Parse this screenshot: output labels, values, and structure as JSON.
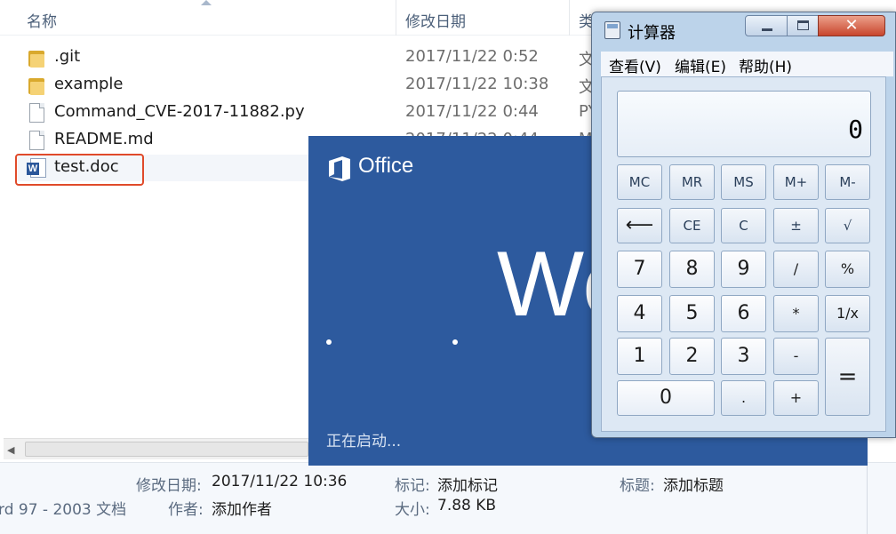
{
  "explorer": {
    "columns": {
      "name": "名称",
      "modified": "修改日期",
      "type": "类"
    },
    "files": [
      {
        "name": ".git",
        "modified": "2017/11/22 0:52",
        "type": "文",
        "icon": "folder-icon"
      },
      {
        "name": "example",
        "modified": "2017/11/22 10:38",
        "type": "文",
        "icon": "folder-icon"
      },
      {
        "name": "Command_CVE-2017-11882.py",
        "modified": "2017/11/22 0:44",
        "type": "PY",
        "icon": "file-icon"
      },
      {
        "name": "README.md",
        "modified": "2017/11/22 0:44",
        "type": "M",
        "icon": "file-icon"
      },
      {
        "name": "test.doc",
        "modified": "",
        "type": "",
        "icon": "word-doc-icon",
        "selected": true
      }
    ],
    "highlight_color": "#e04a2a"
  },
  "details": {
    "modified_label": "修改日期:",
    "modified_value": "2017/11/22 10:36",
    "tags_label": "标记:",
    "tags_value": "添加标记",
    "title_label": "标题:",
    "title_value": "添加标题",
    "filetype_partial": "rd 97 - 2003 文档",
    "author_label": "作者:",
    "author_value": "添加作者",
    "size_label": "大小:",
    "size_value": "7.88 KB"
  },
  "splash": {
    "brand": "Office",
    "app_partial": "Wo",
    "status": "正在启动...",
    "background": "#2d5a9e"
  },
  "calculator": {
    "title": "计算器",
    "window_buttons": {
      "minimize": "",
      "maximize": "",
      "close": "✕"
    },
    "menu": [
      "查看(V)",
      "编辑(E)",
      "帮助(H)"
    ],
    "display": "0",
    "memory_row": [
      "MC",
      "MR",
      "MS",
      "M+",
      "M-"
    ],
    "keys": {
      "backspace": "⟵",
      "ce": "CE",
      "clear": "C",
      "negate": "±",
      "sqrt": "√",
      "d7": "7",
      "d8": "8",
      "d9": "9",
      "divide": "/",
      "percent": "%",
      "d4": "4",
      "d5": "5",
      "d6": "6",
      "multiply": "*",
      "reciprocal": "1/x",
      "d1": "1",
      "d2": "2",
      "d3": "3",
      "subtract": "-",
      "equals": "=",
      "d0": "0",
      "decimal": ".",
      "add": "+"
    }
  }
}
